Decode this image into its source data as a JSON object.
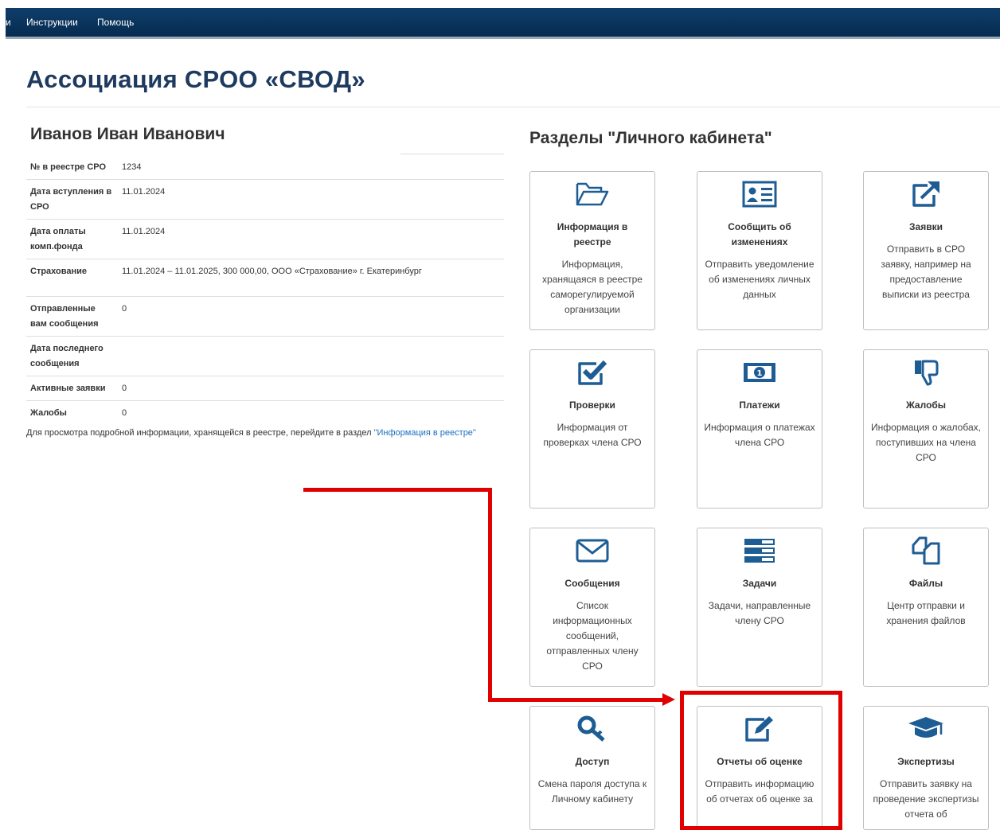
{
  "navbar": {
    "items": [
      "и",
      "Инструкции",
      "Помощь"
    ]
  },
  "page": {
    "title": "Ассоциация СРОО «СВОД»"
  },
  "profile": {
    "name": "Иванов Иван Иванович",
    "rows": [
      {
        "label": "№ в реестре СРО",
        "value": "1234"
      },
      {
        "label": "Дата вступления в СРО",
        "value": "11.01.2024"
      },
      {
        "label": "Дата оплаты комп.фонда",
        "value": "11.01.2024"
      },
      {
        "label": "Страхование",
        "value": "11.01.2024 – 11.01.2025, 300 000,00, ООО «Страхование» г. Екатеринбург"
      },
      {
        "label": "Отправленные вам сообщения",
        "value": "0"
      },
      {
        "label": "Дата последнего сообщения",
        "value": ""
      },
      {
        "label": "Активные заявки",
        "value": "0"
      },
      {
        "label": "Жалобы",
        "value": "0"
      }
    ],
    "note_text": "Для просмотра подробной информации, хранящейся в реестре, перейдите в раздел ",
    "note_link": "\"Информация в реестре\""
  },
  "sections": {
    "title": "Разделы \"Личного кабинета\"",
    "cards": [
      {
        "icon": "folder-open-icon",
        "title": "Информация в реестре",
        "desc": "Информация, хранящаяся в реестре саморегулируемой организации"
      },
      {
        "icon": "id-card-icon",
        "title": "Сообщить об изменениях",
        "desc": "Отправить уведомление об изменениях личных данных"
      },
      {
        "icon": "external-link-icon",
        "title": "Заявки",
        "desc": "Отправить в СРО заявку, например на предоставление выписки из реестра"
      },
      {
        "icon": "check-square-icon",
        "title": "Проверки",
        "desc": "Информация от проверках члена СРО"
      },
      {
        "icon": "money-icon",
        "title": "Платежи",
        "desc": "Информация о платежах члена СРО"
      },
      {
        "icon": "thumbs-down-icon",
        "title": "Жалобы",
        "desc": "Информация о жалобах, поступивших на члена СРО"
      },
      {
        "icon": "envelope-icon",
        "title": "Сообщения",
        "desc": "Список информационных сообщений, отправленных члену СРО"
      },
      {
        "icon": "tasks-icon",
        "title": "Задачи",
        "desc": "Задачи, направленные члену СРО"
      },
      {
        "icon": "files-icon",
        "title": "Файлы",
        "desc": "Центр отправки и хранения файлов"
      },
      {
        "icon": "key-icon",
        "title": "Доступ",
        "desc": "Смена пароля доступа к Личному кабинету"
      },
      {
        "icon": "edit-icon",
        "title": "Отчеты об оценке",
        "desc": "Отправить информацию об отчетах об оценке за"
      },
      {
        "icon": "graduation-cap-icon",
        "title": "Экспертизы",
        "desc": "Отправить заявку на проведение экспертизы отчета об"
      }
    ]
  },
  "colors": {
    "navbar": "#0b3761",
    "accent": "#1e5d94",
    "annotation": "#e00000",
    "link": "#1a6fc1"
  }
}
